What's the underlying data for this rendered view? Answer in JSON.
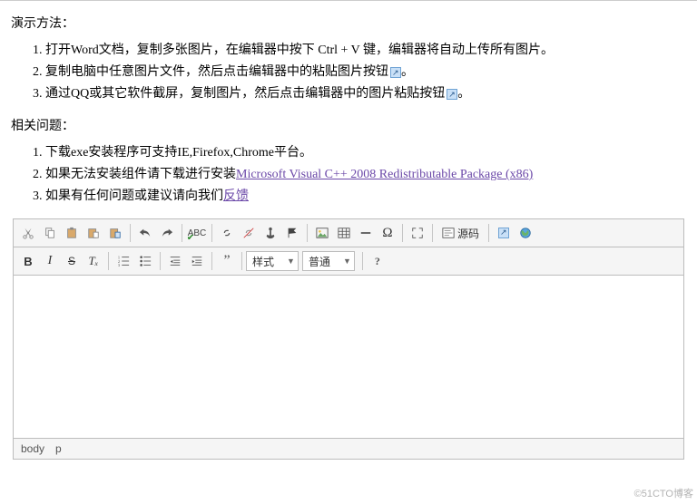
{
  "doc": {
    "heading1": "演示方法：",
    "demo": [
      "打开Word文档，复制多张图片，在编辑器中按下 Ctrl + V 键，编辑器将自动上传所有图片。",
      "复制电脑中任意图片文件，然后点击编辑器中的粘贴图片按钮",
      "通过QQ或其它软件截屏，复制图片，然后点击编辑器中的图片粘贴按钮"
    ],
    "demo_tail2": "。",
    "demo_tail3": "。",
    "heading2": "相关问题：",
    "faq1": "下载exe安装程序可支持IE,Firefox,Chrome平台。",
    "faq2_pre": "如果无法安装组件请下载进行安装",
    "faq2_link": "Microsoft Visual C++ 2008 Redistributable Package (x86)",
    "faq3_pre": "如果有任何问题或建议请向我们",
    "faq3_link": "反馈"
  },
  "editor": {
    "styles_label": "样式",
    "format_label": "普通",
    "source_label": "源码",
    "omega": "Ω",
    "question": "?",
    "b": "B",
    "i": "I",
    "s": "S",
    "tx": "Tₓ"
  },
  "status": {
    "body": "body",
    "p": "p"
  },
  "watermark": "©51CTO博客"
}
